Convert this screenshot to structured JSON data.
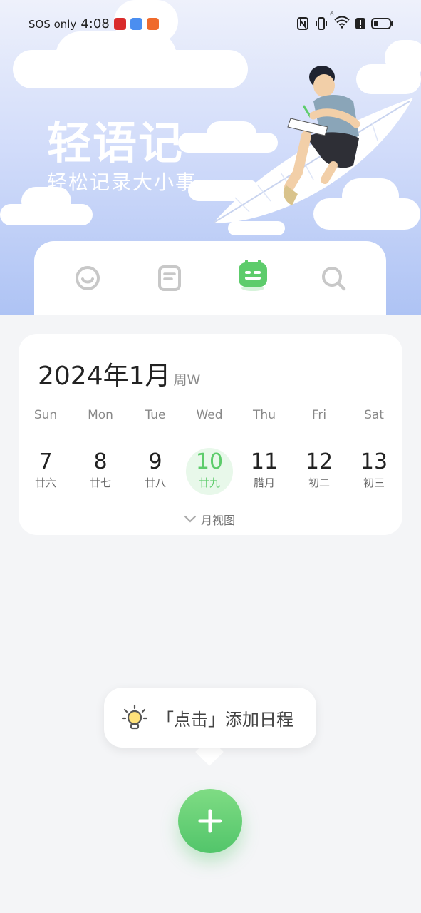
{
  "status_bar": {
    "carrier": "SOS only",
    "time": "4:08",
    "signal_label": "6"
  },
  "header": {
    "title": "轻语记",
    "subtitle": "轻松记录大小事"
  },
  "tabs": [
    {
      "name": "mood",
      "icon": "smile-face-icon",
      "active": false
    },
    {
      "name": "notes",
      "icon": "notebook-icon",
      "active": false
    },
    {
      "name": "schedule",
      "icon": "calendar-robot-icon",
      "active": true
    },
    {
      "name": "search",
      "icon": "search-icon",
      "active": false
    }
  ],
  "calendar": {
    "month_label": "2024年1月",
    "week_hint": "周W",
    "weekdays": [
      "Sun",
      "Mon",
      "Tue",
      "Wed",
      "Thu",
      "Fri",
      "Sat"
    ],
    "days": [
      {
        "num": "7",
        "lunar": "廿六"
      },
      {
        "num": "8",
        "lunar": "廿七"
      },
      {
        "num": "9",
        "lunar": "廿八"
      },
      {
        "num": "10",
        "lunar": "廿九"
      },
      {
        "num": "11",
        "lunar": "腊月"
      },
      {
        "num": "12",
        "lunar": "初二"
      },
      {
        "num": "13",
        "lunar": "初三"
      }
    ],
    "selected_index": 3,
    "month_view_label": "月视图"
  },
  "tip": {
    "text": "「点击」添加日程"
  },
  "colors": {
    "accent": "#5dcc6b",
    "hero_top": "#eef1fb",
    "hero_bottom": "#aec3f4"
  }
}
